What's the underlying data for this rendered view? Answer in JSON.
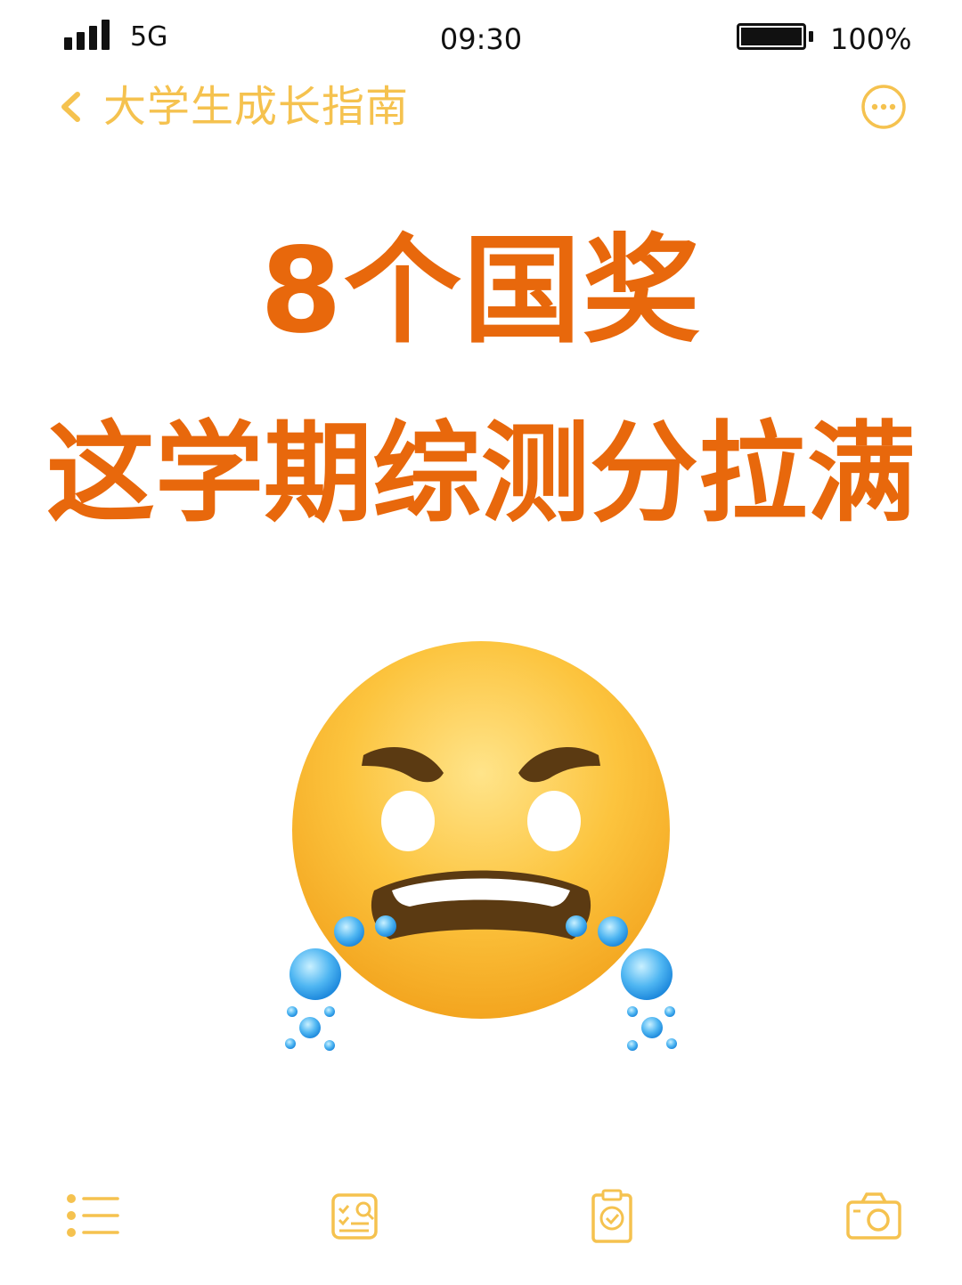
{
  "status_bar": {
    "network": "5G",
    "time": "09:30",
    "battery": "100%"
  },
  "nav": {
    "title": "大学生成长指南",
    "back_icon": "chevron-left-icon",
    "more_icon": "more-circle-icon"
  },
  "headline": {
    "line1": "8个国奖",
    "line2": "这学期综测分拉满"
  },
  "illustration": {
    "emoji": "angry-crying-face-emoji"
  },
  "toolbar": {
    "items": [
      {
        "icon": "list-icon"
      },
      {
        "icon": "checklist-search-icon"
      },
      {
        "icon": "clipboard-check-icon"
      },
      {
        "icon": "camera-icon"
      }
    ]
  },
  "colors": {
    "accent": "#F5C24F",
    "headline": "#E8680C"
  }
}
